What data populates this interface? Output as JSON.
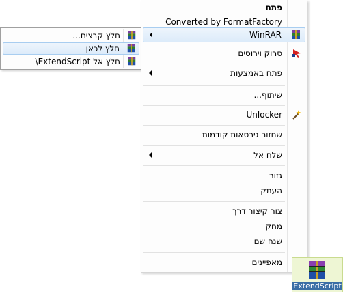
{
  "context_menu": {
    "items": [
      {
        "label": "פתח",
        "bold": true
      },
      {
        "label": "Converted by FormatFactory"
      },
      {
        "label": "WinRAR",
        "icon": "winrar-icon",
        "submenu": true,
        "highlighted": true
      },
      {
        "label": "סרוק וירוסים",
        "icon": "antivirus-icon"
      },
      {
        "label": "פתח באמצעות",
        "submenu": true
      },
      {
        "label": "שיתוף..."
      },
      {
        "label": "Unlocker",
        "icon": "unlocker-wand-icon"
      },
      {
        "label": "שחזור גירסאות קודמות"
      },
      {
        "label": "שלח אל",
        "submenu": true
      },
      {
        "label": "גזור"
      },
      {
        "label": "העתק"
      },
      {
        "label": "צור קיצור דרך"
      },
      {
        "label": "מחק"
      },
      {
        "label": "שנה שם"
      },
      {
        "label": "מאפיינים"
      }
    ]
  },
  "winrar_submenu": {
    "items": [
      {
        "label": "חלץ קבצים...",
        "icon": "winrar-icon"
      },
      {
        "label": "חלץ לכאן",
        "icon": "winrar-icon",
        "highlighted": true
      },
      {
        "label": "חלץ אל ExtendScript\\",
        "icon": "winrar-icon"
      }
    ]
  },
  "desktop_icon": {
    "label": "ExtendScript",
    "icon": "winrar-archive-icon"
  },
  "colors": {
    "highlight_top": "#eef5fc",
    "highlight_bottom": "#dcebfa",
    "highlight_border": "#a8cdf0",
    "icon_selection_bg": "#eef6d4",
    "caption_bg": "#3a6ea5"
  }
}
